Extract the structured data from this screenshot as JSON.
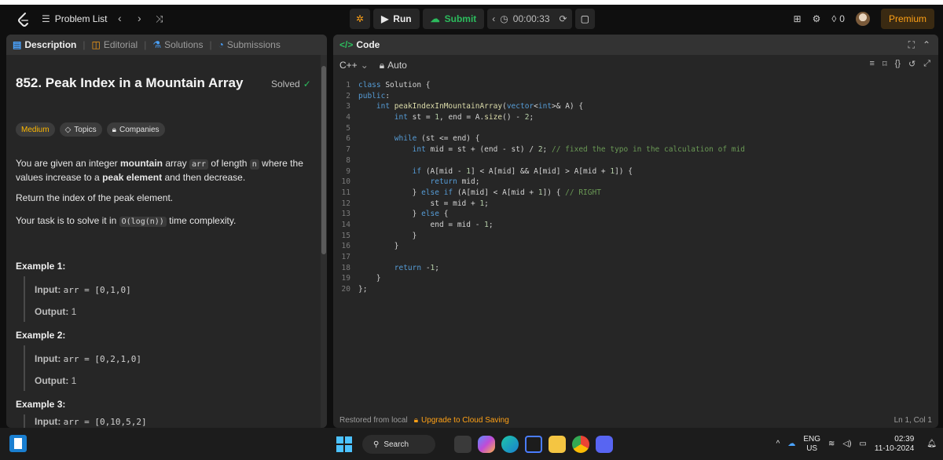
{
  "topbar": {
    "problem_list": "Problem List",
    "run": "Run",
    "submit": "Submit",
    "timer": "00:00:33",
    "streak": "0",
    "premium": "Premium"
  },
  "left": {
    "tabs": [
      "Description",
      "Editorial",
      "Solutions",
      "Submissions"
    ],
    "title": "852. Peak Index in a Mountain Array",
    "solved": "Solved",
    "chips": [
      "Medium",
      "Topics",
      "Companies"
    ],
    "p1_a": "You are given an integer ",
    "p1_b": "mountain",
    "p1_c": " array ",
    "p1_arr": "arr",
    "p1_d": " of length ",
    "p1_n": "n",
    "p1_e": " where the values increase to a ",
    "p1_f": "peak element",
    "p1_g": " and then decrease.",
    "p2": "Return the index of the peak element.",
    "p3_a": "Your task is to solve it in ",
    "p3_code": "O(log(n))",
    "p3_b": " time complexity.",
    "examples": [
      {
        "title": "Example 1:",
        "input_label": "Input:",
        "input": "arr = [0,1,0]",
        "output_label": "Output:",
        "output": "1"
      },
      {
        "title": "Example 2:",
        "input_label": "Input:",
        "input": "arr = [0,2,1,0]",
        "output_label": "Output:",
        "output": "1"
      },
      {
        "title": "Example 3:",
        "input_label": "Input:",
        "input": "arr = [0,10,5,2]"
      }
    ]
  },
  "right": {
    "tab": "Code",
    "language": "C++",
    "auto": "Auto",
    "footer_restored": "Restored from local",
    "footer_upgrade": "Upgrade to Cloud Saving",
    "footer_pos": "Ln 1, Col 1",
    "code_lines": [
      "class Solution {",
      "public:",
      "    int peakIndexInMountainArray(vector<int>& A) {",
      "        int st = 1, end = A.size() - 2;",
      "",
      "        while (st <= end) {",
      "            int mid = st + (end - st) / 2; // fixed the typo in the calculation of mid",
      "",
      "            if (A[mid - 1] < A[mid] && A[mid] > A[mid + 1]) {",
      "                return mid;",
      "            } else if (A[mid] < A[mid + 1]) { // RIGHT",
      "                st = mid + 1;",
      "            } else {",
      "                end = mid - 1;",
      "            }",
      "        }",
      "",
      "        return -1;",
      "    }",
      "};"
    ]
  },
  "taskbar": {
    "search": "Search",
    "lang_top": "ENG",
    "lang_bottom": "US",
    "time": "02:39",
    "date": "11-10-2024"
  }
}
